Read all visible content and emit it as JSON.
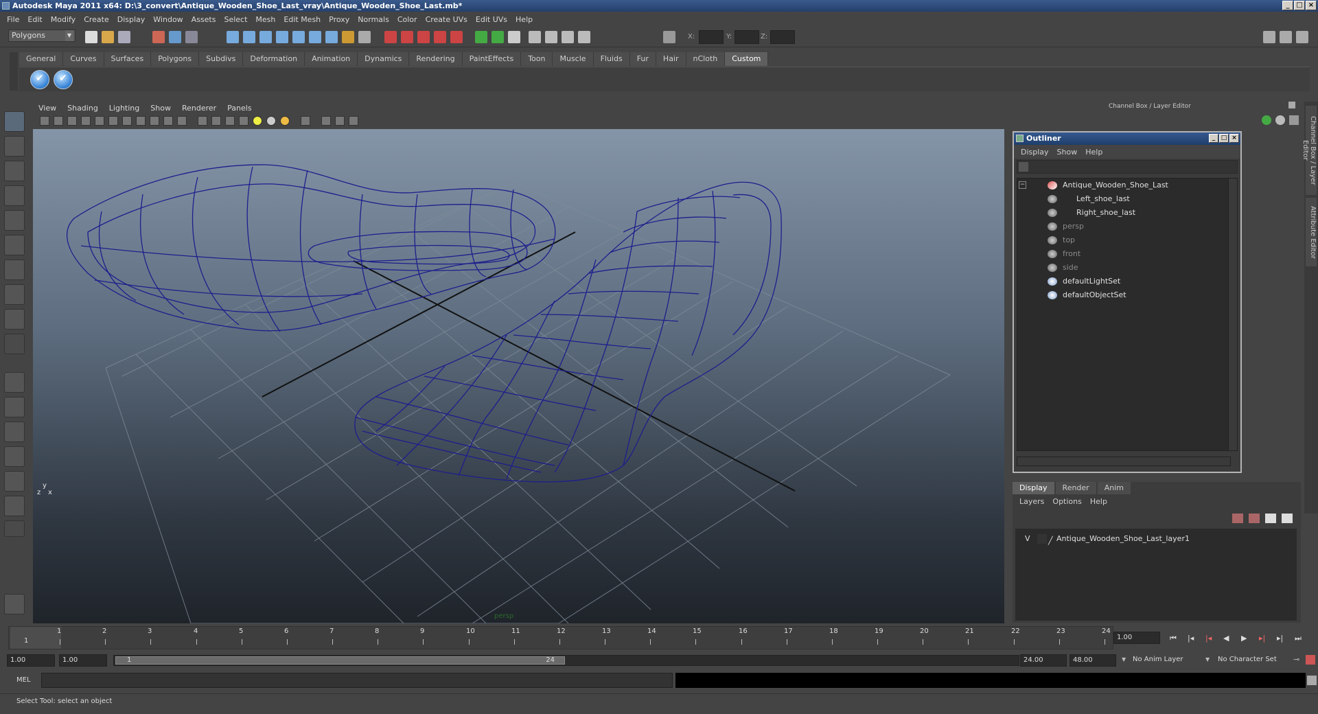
{
  "window": {
    "title": "Autodesk Maya 2011 x64: D:\\3_convert\\Antique_Wooden_Shoe_Last_vray\\Antique_Wooden_Shoe_Last.mb*"
  },
  "menubar": [
    "File",
    "Edit",
    "Modify",
    "Create",
    "Display",
    "Window",
    "Assets",
    "Select",
    "Mesh",
    "Edit Mesh",
    "Proxy",
    "Normals",
    "Color",
    "Create UVs",
    "Edit UVs",
    "Help"
  ],
  "status": {
    "mode": "Polygons",
    "x_label": "X:",
    "y_label": "Y:",
    "z_label": "Z:"
  },
  "shelf": {
    "tabs": [
      "General",
      "Curves",
      "Surfaces",
      "Polygons",
      "Subdivs",
      "Deformation",
      "Animation",
      "Dynamics",
      "Rendering",
      "PaintEffects",
      "Toon",
      "Muscle",
      "Fluids",
      "Fur",
      "Hair",
      "nCloth",
      "Custom"
    ],
    "active_tab": "Custom"
  },
  "viewport": {
    "menu": [
      "View",
      "Shading",
      "Lighting",
      "Show",
      "Renderer",
      "Panels"
    ],
    "camera_label": "persp",
    "axis_y": "y",
    "axis_x": "x",
    "axis_z": "z"
  },
  "channel_box": {
    "header": "Channel Box / Layer Editor"
  },
  "side_tabs": [
    "Channel Box / Layer Editor",
    "Attribute Editor"
  ],
  "outliner": {
    "title": "Outliner",
    "menu": [
      "Display",
      "Show",
      "Help"
    ],
    "items": [
      {
        "label": "Antique_Wooden_Shoe_Last",
        "dim": false
      },
      {
        "label": "Left_shoe_last",
        "dim": false
      },
      {
        "label": "Right_shoe_last",
        "dim": false
      },
      {
        "label": "persp",
        "dim": true
      },
      {
        "label": "top",
        "dim": true
      },
      {
        "label": "front",
        "dim": true
      },
      {
        "label": "side",
        "dim": true
      },
      {
        "label": "defaultLightSet",
        "dim": false
      },
      {
        "label": "defaultObjectSet",
        "dim": false
      }
    ]
  },
  "layers": {
    "tabs": [
      "Display",
      "Render",
      "Anim"
    ],
    "active_tab": "Display",
    "menu": [
      "Layers",
      "Options",
      "Help"
    ],
    "rows": [
      {
        "visibility": "V",
        "name": "Antique_Wooden_Shoe_Last_layer1"
      }
    ]
  },
  "timeline": {
    "ticks": [
      "1",
      "2",
      "3",
      "4",
      "5",
      "6",
      "7",
      "8",
      "9",
      "10",
      "11",
      "12",
      "13",
      "14",
      "15",
      "16",
      "17",
      "18",
      "19",
      "20",
      "21",
      "22",
      "23",
      "24"
    ],
    "current_frame_label": "1",
    "current_time": "1.00"
  },
  "range": {
    "start": "1.00",
    "playback_start": "1.00",
    "slider_start": "1",
    "slider_end": "24",
    "playback_end": "24.00",
    "end": "48.00",
    "anim_layer": "No Anim Layer",
    "char_set": "No Character Set"
  },
  "cmdline": {
    "label": "MEL"
  },
  "helpline": {
    "text": "Select Tool: select an object"
  }
}
